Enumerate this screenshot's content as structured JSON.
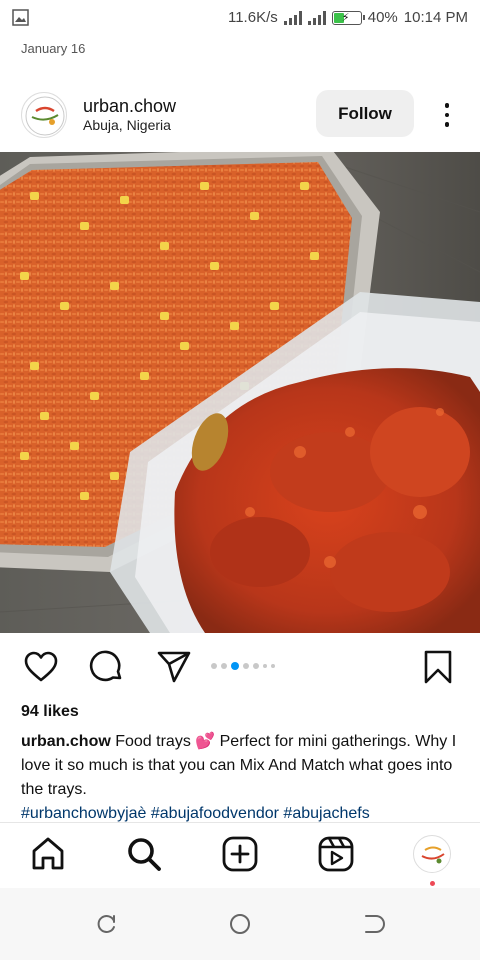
{
  "status_bar": {
    "speed": "11.6K/s",
    "battery": "40%",
    "battery_level": 0.4,
    "time": "10:14 PM"
  },
  "post": {
    "date": "January 16",
    "username": "urban.chow",
    "location": "Abuja, Nigeria",
    "follow_label": "Follow",
    "carousel": {
      "count": 7,
      "active_index": 2
    },
    "likes": "94 likes",
    "caption_user": "urban.chow",
    "caption_text": " Food trays 💕 Perfect for mini gatherings. Why I love it so much is that you can Mix And Match what goes into the trays.",
    "hashtags": "#urbanchowbyjaè #abujafoodvendor #abujachefs"
  },
  "icons": {
    "status_left": "image-icon",
    "actions": [
      "heart-icon",
      "comment-icon",
      "share-icon",
      "bookmark-icon"
    ],
    "bottom_nav": [
      "home-icon",
      "search-icon",
      "create-icon",
      "reels-icon",
      "profile-avatar"
    ],
    "system_nav": [
      "recents-icon",
      "home-circle-icon",
      "back-icon"
    ]
  },
  "colors": {
    "hashtag": "#00376b",
    "follow_bg": "#efefef",
    "notification_dot": "#ed4956",
    "battery_fill": "#3cc24a"
  }
}
